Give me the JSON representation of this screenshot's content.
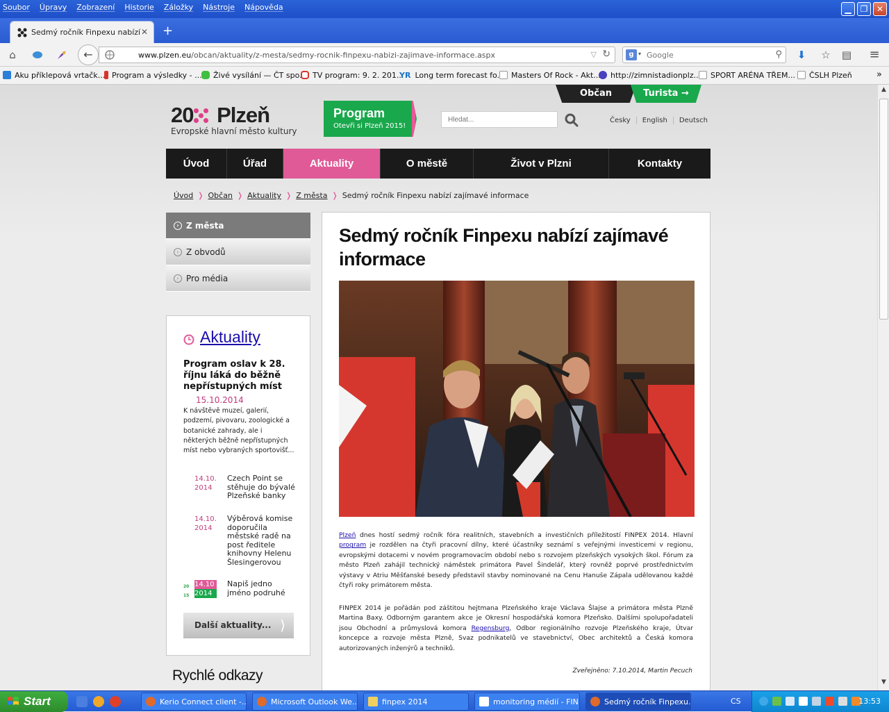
{
  "browser": {
    "menu": [
      "Soubor",
      "Úpravy",
      "Zobrazení",
      "Historie",
      "Záložky",
      "Nástroje",
      "Nápověda"
    ],
    "tab_title": "Sedmý ročník Finpexu nabízí z...",
    "url_host": "www.plzen.eu",
    "url_path": "/obcan/aktuality/z-mesta/sedmy-rocnik-finpexu-nabizi-zajimave-informace.aspx",
    "search_placeholder": "Google",
    "bookmarks": [
      "Aku příklepová vrtačk...",
      "Program a výsledky - ...",
      "Živé vysílání — ČT spo...",
      "TV program: 9. 2. 201...",
      "Long term forecast fo...",
      "Masters Of Rock - Akt...",
      "http://zimnistadionplz...",
      "SPORT ARÉNA TŘEM...",
      "ČSLH Plzeň"
    ]
  },
  "site": {
    "top_tabs": {
      "citizen": "Občan",
      "tourist": "Turista →"
    },
    "logo": {
      "year_a": "20",
      "year_b": "15",
      "city": "Plzeň",
      "subtitle": "Evropské hlavní město kultury"
    },
    "program": {
      "title": "Program",
      "subtitle": "Otevři si Plzeň 2015!"
    },
    "search_placeholder": "Hledat...",
    "languages": [
      "Česky",
      "English",
      "Deutsch"
    ],
    "nav": [
      "Úvod",
      "Úřad",
      "Aktuality",
      "O městě",
      "Život v Plzni",
      "Kontakty"
    ],
    "breadcrumb": [
      "Úvod",
      "Občan",
      "Aktuality",
      "Z města"
    ],
    "breadcrumb_current": "Sedmý ročník Finpexu nabízí zajímavé informace",
    "submenu": [
      "Z města",
      "Z obvodů",
      "Pro média"
    ],
    "news": {
      "heading": "Aktuality",
      "featured_title": "Program oslav k 28. říjnu láká do běžně nepřístupných míst",
      "featured_date": "15.10.2014",
      "featured_text": "K návštěvě muzeí, galerií, podzemí, pivovaru, zoologické a botanické zahrady, ale i některých běžně nepřístupných míst nebo vybraných sportovišť...",
      "items": [
        {
          "date": "14.10. 2014",
          "title": "Czech Point se stěhuje do bývalé Plzeňské banky"
        },
        {
          "date": "14.10. 2014",
          "title": "Výběrová komise doporučila městské radě na post ředitele knihovny Helenu Šlesingerovou"
        },
        {
          "date": "14.10 2014",
          "title": "Napiš jedno jméno podruhé"
        }
      ],
      "more": "Další aktuality..."
    },
    "quick_links_title": "Rychlé odkazy"
  },
  "article": {
    "title": "Sedmý ročník Finpexu nabízí zajímavé informace",
    "p1_link1": "Plzeň",
    "p1_a": " dnes hostí sedmý ročník fóra realitních, stavebních a investičních příležitostí FINPEX 2014. Hlavní ",
    "p1_link2": "program",
    "p1_b": " je rozdělen na čtyři pracovní dílny, které účastníky seznámí s veřejnými investicemi v regionu, evropskými dotacemi v novém programovacím období nebo s rozvojem plzeňských vysokých škol. Fórum za město Plzeň zahájil technický náměstek primátora Pavel Šindelář, který rovněž poprvé prostřednictvím výstavy v Atriu Měšťanské besedy představil stavby nominované na Cenu Hanuše Zápala udělovanou každé čtyři roky primátorem města.",
    "p2_a": "FINPEX 2014 je pořádán pod záštitou hejtmana Plzeňského kraje Václava Šlajse a primátora města Plzně Martina Baxy. Odborným garantem akce je Okresní hospodářská komora Plzeňsko. Dalšími spolupořadateli jsou Obchodní a průmyslová komora ",
    "p2_link": "Regensburg",
    "p2_b": ", Odbor regionálního rozvoje Plzeňského kraje, Útvar koncepce a rozvoje města Plzně, Svaz podnikatelů ve stavebnictví, Obec architektů a Česká komora autorizovaných inženýrů a techniků.",
    "published": "Zveřejněno: 7.10.2014, Martin Pecuch"
  },
  "taskbar": {
    "start": "Start",
    "tasks": [
      "Kerio Connect client -...",
      "Microsoft Outlook We...",
      "finpex 2014",
      "monitoring médií - FIN...",
      "Sedmý ročník Finpexu..."
    ],
    "language": "CS",
    "clock": "13:53"
  },
  "colors": {
    "accent_pink": "#e05a97",
    "accent_green": "#19a84c",
    "link": "#1a0dab"
  }
}
